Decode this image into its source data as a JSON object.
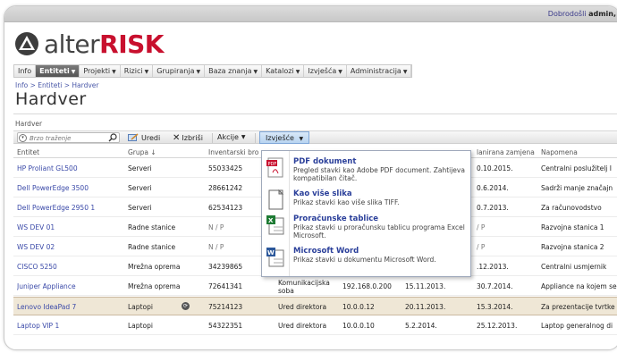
{
  "header": {
    "welcome_prefix": "Dobrodošli",
    "welcome_user": "admin,"
  },
  "logo": {
    "part1": "alter",
    "part2": "RISK"
  },
  "nav": [
    {
      "label": "Info",
      "active": false,
      "arrow": false
    },
    {
      "label": "Entiteti",
      "active": true,
      "arrow": true
    },
    {
      "label": "Projekti",
      "active": false,
      "arrow": true
    },
    {
      "label": "Rizici",
      "active": false,
      "arrow": true
    },
    {
      "label": "Grupiranja",
      "active": false,
      "arrow": true
    },
    {
      "label": "Baza znanja",
      "active": false,
      "arrow": true
    },
    {
      "label": "Katalozi",
      "active": false,
      "arrow": true
    },
    {
      "label": "Izvješća",
      "active": false,
      "arrow": true
    },
    {
      "label": "Administracija",
      "active": false,
      "arrow": true
    }
  ],
  "breadcrumb": "Info > Entiteti > Hardver",
  "page_title": "Hardver",
  "list_name": "Hardver",
  "toolbar": {
    "search_placeholder": "Brzo traženje",
    "edit_label": "Uredi",
    "delete_label": "Izbriši",
    "actions_label": "Akcije",
    "reports_label": "Izvješće"
  },
  "columns": [
    "Entitet",
    "Grupa",
    "Inventarski bro",
    "",
    "",
    "",
    "lanirana zamjena",
    "Napomena"
  ],
  "group_sort_arrow": "↓",
  "rows": [
    {
      "entitet": "HP Proliant GL500",
      "grupa": "Serveri",
      "inv": "55033425",
      "lok": "",
      "ip": "",
      "d1": "",
      "zam": "0.10.2015.",
      "nap": "Centralni poslužitelj I"
    },
    {
      "entitet": "Dell PowerEdge 3500",
      "grupa": "Serveri",
      "inv": "28661242",
      "lok": "",
      "ip": "",
      "d1": "",
      "zam": "0.6.2014.",
      "nap": "Sadrži manje značajn"
    },
    {
      "entitet": "Dell PowerEdge 2950 1",
      "grupa": "Serveri",
      "inv": "62534123",
      "lok": "",
      "ip": "",
      "d1": "",
      "zam": "0.7.2013.",
      "nap": "Za računovodstvo"
    },
    {
      "entitet": "WS DEV 01",
      "grupa": "Radne stanice",
      "inv": "N / P",
      "lok": "",
      "ip": "",
      "d1": "",
      "zam": "/ P",
      "nap": "Razvojna stanica 1"
    },
    {
      "entitet": "WS DEV 02",
      "grupa": "Radne stanice",
      "inv": "N / P",
      "lok": "",
      "ip": "",
      "d1": "",
      "zam": "/ P",
      "nap": "Razvojna stanica 2"
    },
    {
      "entitet": "CISCO 5250",
      "grupa": "Mrežna oprema",
      "inv": "34239865",
      "lok": "",
      "ip": "",
      "d1": "",
      "zam": ".12.2013.",
      "nap": "Centralni usmjernik"
    },
    {
      "entitet": "Juniper Appliance",
      "grupa": "Mrežna oprema",
      "inv": "72641341",
      "lok": "Komunikacijska soba",
      "ip": "192.168.0.200",
      "d1": "15.11.2013.",
      "zam": "30.7.2014.",
      "nap": "Appliance na kojem se"
    },
    {
      "entitet": "Lenovo IdeaPad 7",
      "grupa": "Laptopi",
      "inv": "75214123",
      "lok": "Ured direktora",
      "ip": "10.0.0.12",
      "d1": "20.11.2013.",
      "zam": "15.3.2014.",
      "nap": "Za prezentacije tvrtke"
    },
    {
      "entitet": "Laptop VIP 1",
      "grupa": "Laptopi",
      "inv": "54322351",
      "lok": "Ured direktora",
      "ip": "10.0.0.10",
      "d1": "5.2.2014.",
      "zam": "25.12.2013.",
      "nap": "Laptop generalnog di"
    }
  ],
  "highlighted_row_icon": "⟳",
  "dropdown": [
    {
      "icon": "pdf-icon",
      "title": "PDF dokument",
      "desc": "Pregled stavki kao Adobe PDF document. Zahtijeva kompatibilan čitač."
    },
    {
      "icon": "image-icon",
      "title": "Kao više slika",
      "desc": "Prikaz stavki kao više slika TIFF."
    },
    {
      "icon": "excel-icon",
      "title": "Proračunske tablice",
      "desc": "Prikaz stavki u proračunsku tablicu programa Excel Microsoft."
    },
    {
      "icon": "word-icon",
      "title": "Microsoft Word",
      "desc": "Prikaz stavki u dokumentu Microsoft Word."
    }
  ],
  "colors": {
    "brand_red": "#c8102e",
    "link_blue": "#3a49a8",
    "row_highlight": "#efe7d6",
    "active_menu": "#b8d4f0"
  }
}
